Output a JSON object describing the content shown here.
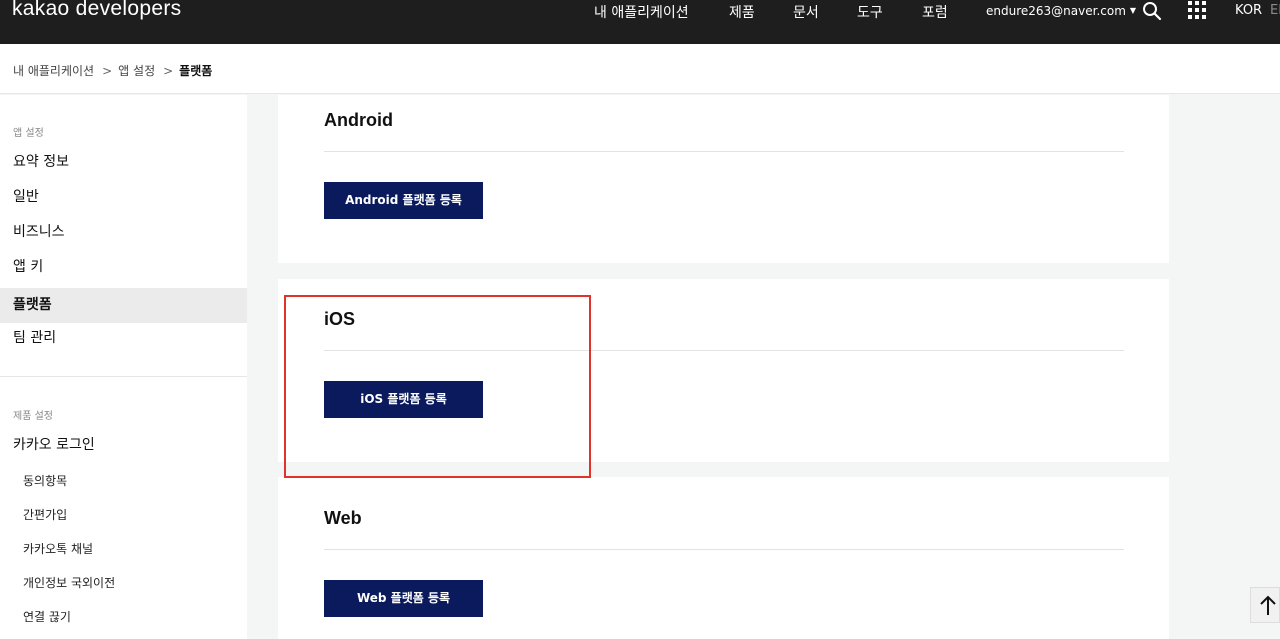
{
  "header": {
    "logo": "kakao developers",
    "nav": [
      "내 애플리케이션",
      "제품",
      "문서",
      "도구",
      "포럼"
    ],
    "user_email": "endure263@naver.com",
    "lang_kor": "KOR",
    "lang_en": "EN",
    "icons": [
      "search-icon",
      "apps-grid-icon"
    ]
  },
  "breadcrumb": {
    "items": [
      "내 애플리케이션",
      "앱 설정",
      "플랫폼"
    ],
    "separator": ">"
  },
  "sidebar": {
    "section1_heading": "앱 설정",
    "section1_items": [
      "요약 정보",
      "일반",
      "비즈니스",
      "앱 키",
      "플랫폼",
      "팀 관리"
    ],
    "active_item": "플랫폼",
    "section2_heading": "제품 설정",
    "section2_title": "카카오 로그인",
    "section2_subitems": [
      "동의항목",
      "간편가입",
      "카카오톡 채널",
      "개인정보 국외이전",
      "연결 끊기"
    ]
  },
  "panels": [
    {
      "title": "Android",
      "button": "Android 플랫폼 등록"
    },
    {
      "title": "iOS",
      "button": "iOS 플랫폼 등록"
    },
    {
      "title": "Web",
      "button": "Web 플랫폼 등록"
    }
  ],
  "colors": {
    "topbar": "#1e1e1e",
    "button": "#0a1a5c",
    "highlight": "#e0332b"
  }
}
